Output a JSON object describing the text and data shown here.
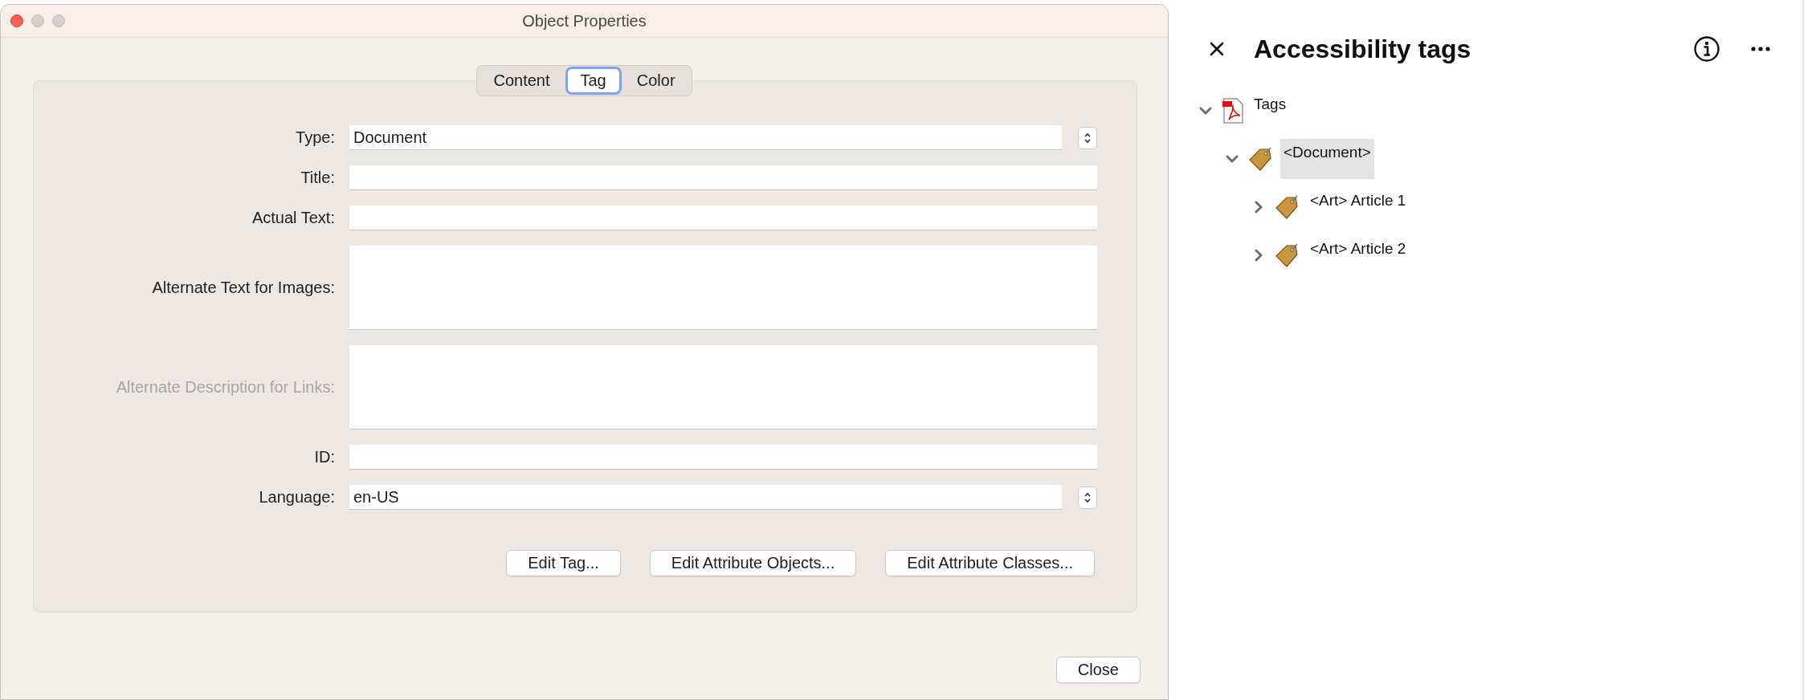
{
  "window": {
    "title": "Object Properties"
  },
  "tabs": [
    {
      "label": "Content",
      "selected": false
    },
    {
      "label": "Tag",
      "selected": true
    },
    {
      "label": "Color",
      "selected": false
    }
  ],
  "fields": [
    {
      "label": "Type:",
      "kind": "popup",
      "value": "Document",
      "disabled": false
    },
    {
      "label": "Title:",
      "kind": "text",
      "disabled": false
    },
    {
      "label": "Actual Text:",
      "kind": "text",
      "disabled": false
    },
    {
      "label": "Alternate Text for Images:",
      "kind": "area",
      "disabled": false
    },
    {
      "label": "Alternate Description for Links:",
      "kind": "area",
      "disabled": true
    },
    {
      "label": "ID:",
      "kind": "text",
      "disabled": false
    },
    {
      "label": "Language:",
      "kind": "popup",
      "value": "en-US",
      "disabled": false
    }
  ],
  "buttons": [
    "Edit Tag...",
    "Edit Attribute Objects...",
    "Edit Attribute Classes..."
  ],
  "close_button": "Close",
  "panel": {
    "title": "Accessibility tags",
    "tree": [
      {
        "label": "Tags",
        "kind": "file",
        "expanded": true,
        "selected": false,
        "children": [
          {
            "label": "<Document>",
            "kind": "tag",
            "expanded": true,
            "selected": true,
            "children": [
              {
                "label": "<Art> Article 1",
                "kind": "tag",
                "expanded": false,
                "selected": false
              },
              {
                "label": "<Art> Article 2",
                "kind": "tag",
                "expanded": false,
                "selected": false
              }
            ]
          }
        ]
      }
    ]
  }
}
